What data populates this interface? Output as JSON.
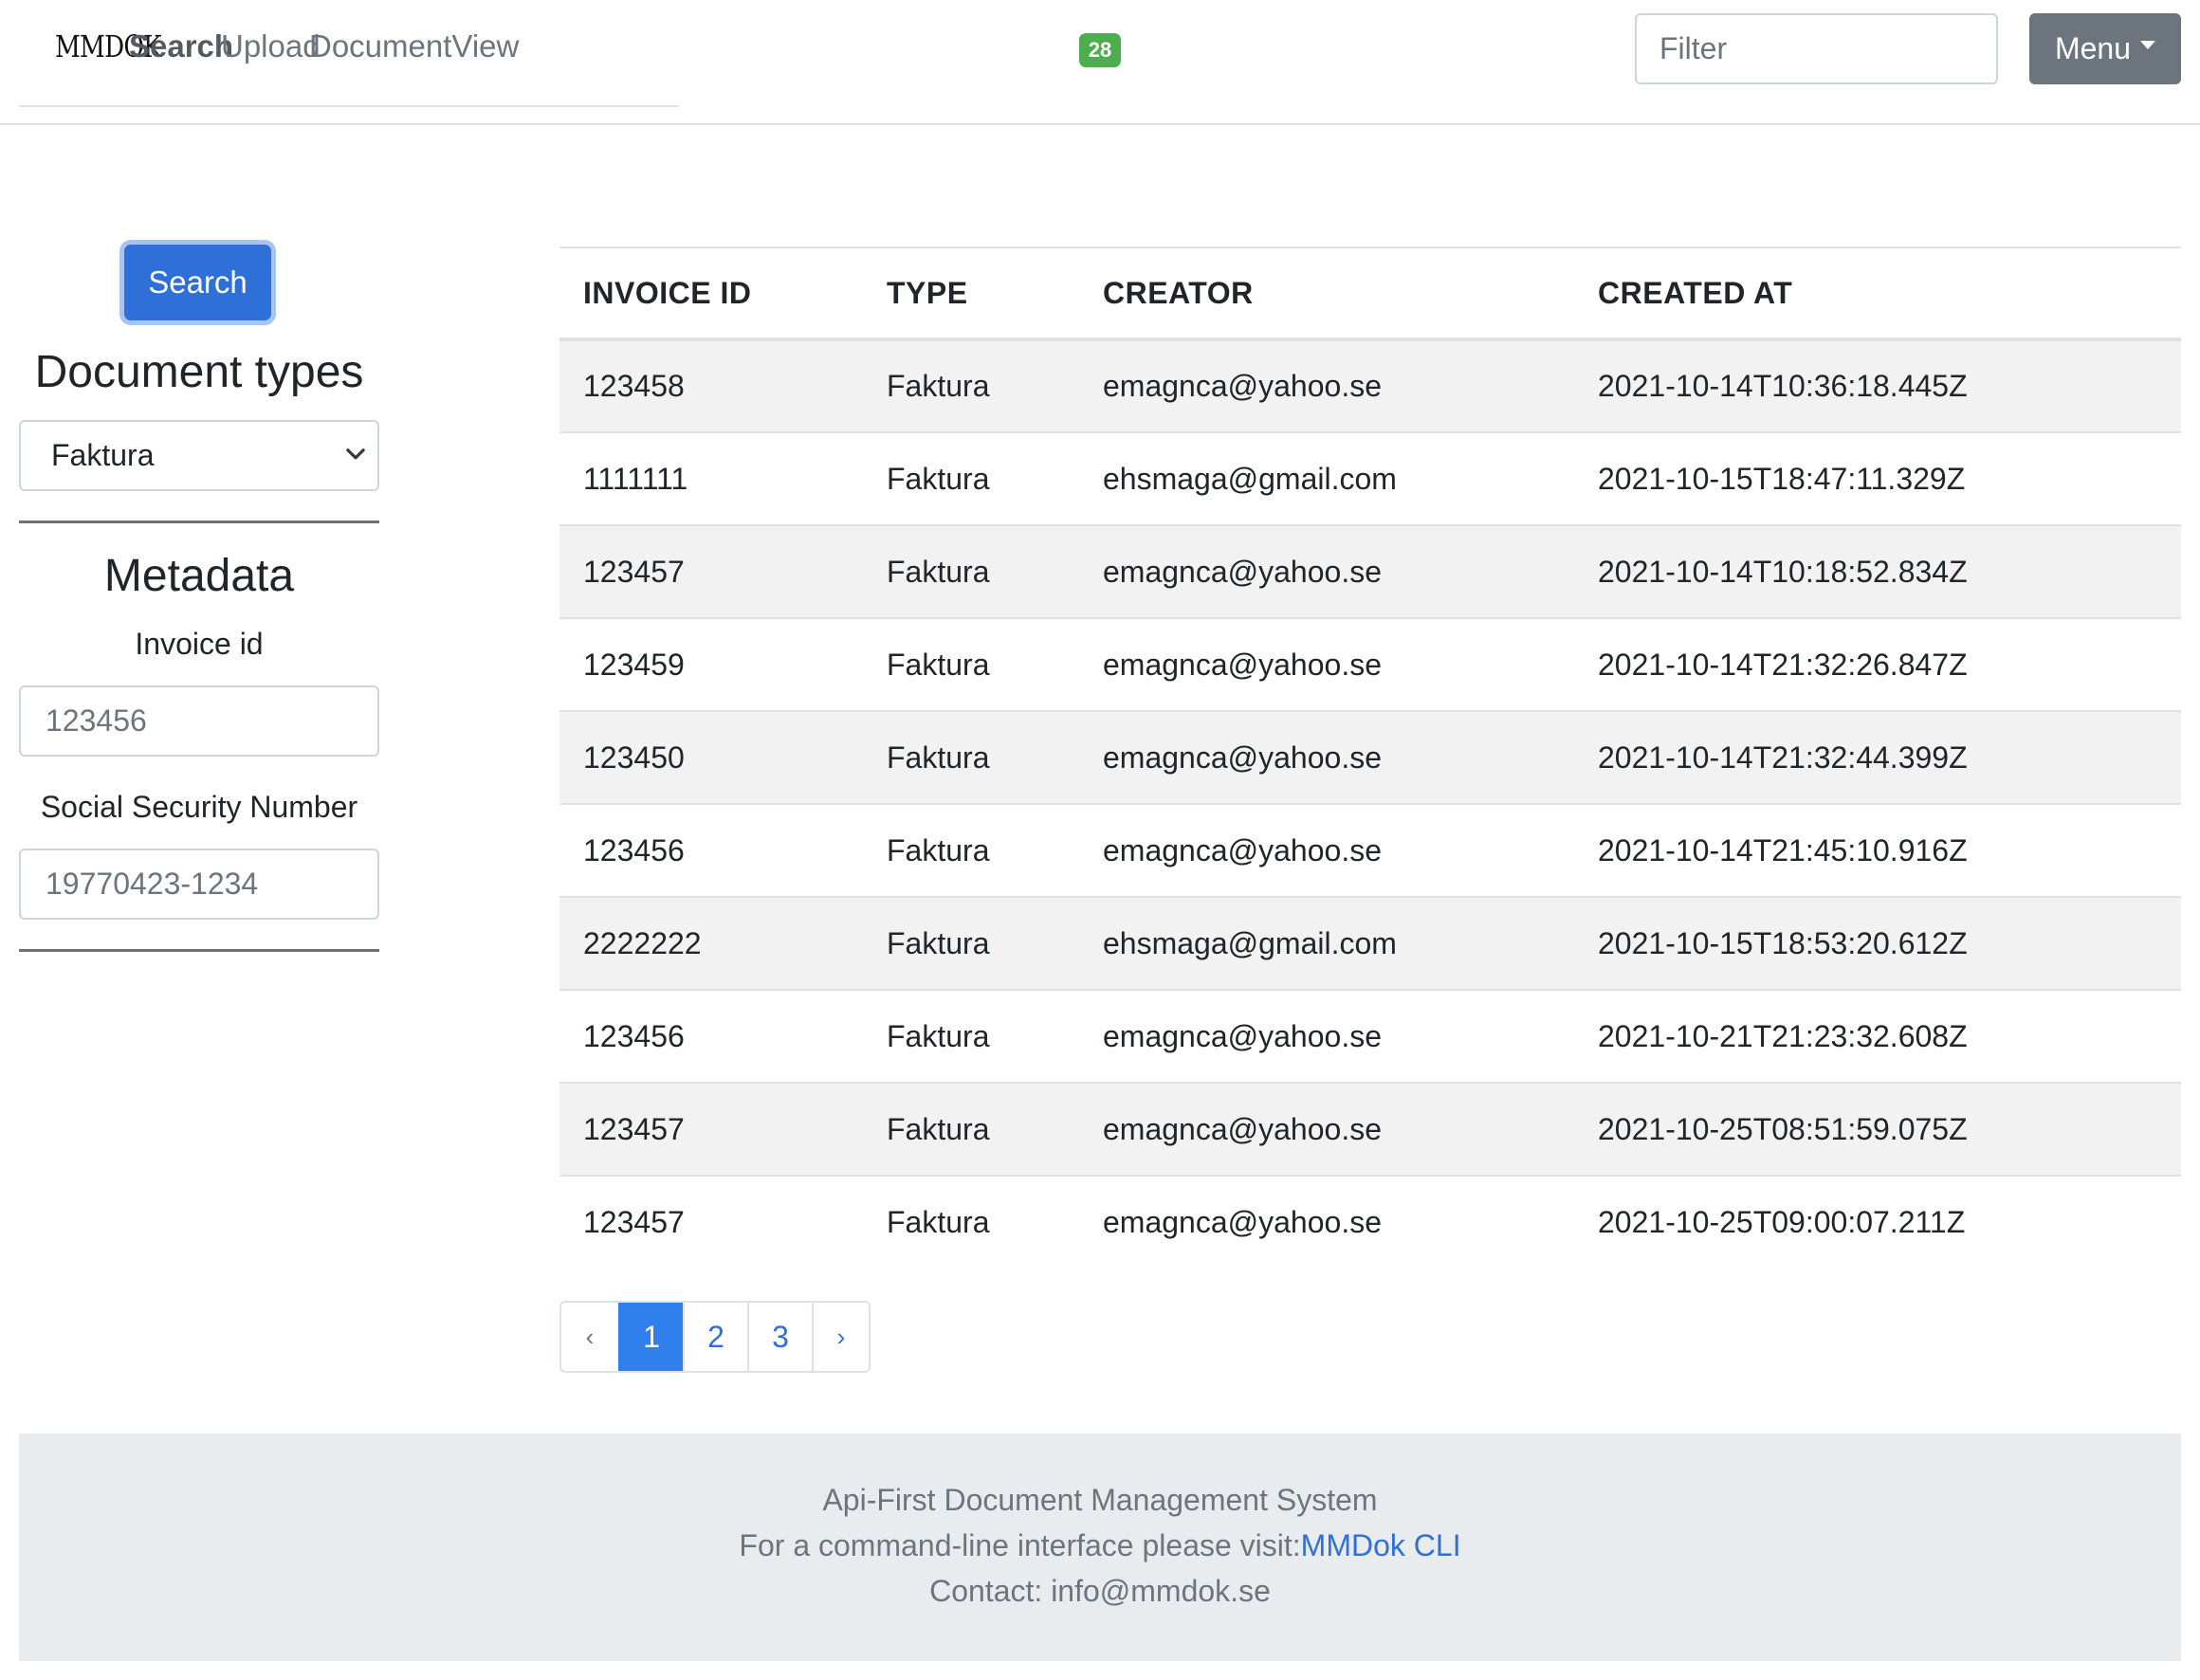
{
  "navbar": {
    "brand": "MMDOK",
    "links": [
      {
        "label": "Search",
        "active": true
      },
      {
        "label": "Upload",
        "active": false
      },
      {
        "label": "DocumentView",
        "active": false
      }
    ],
    "badge": "28",
    "filter_placeholder": "Filter",
    "menu_label": "Menu"
  },
  "sidebar": {
    "search_button": "Search",
    "document_types_heading": "Document types",
    "document_type_selected": "Faktura",
    "metadata_heading": "Metadata",
    "fields": [
      {
        "label": "Invoice id",
        "placeholder": "123456"
      },
      {
        "label": "Social Security Number",
        "placeholder": "19770423-1234"
      }
    ]
  },
  "table": {
    "headers": [
      "INVOICE ID",
      "TYPE",
      "CREATOR",
      "CREATED AT"
    ],
    "rows": [
      [
        "123458",
        "Faktura",
        "emagnca@yahoo.se",
        "2021-10-14T10:36:18.445Z"
      ],
      [
        "1111111",
        "Faktura",
        "ehsmaga@gmail.com",
        "2021-10-15T18:47:11.329Z"
      ],
      [
        "123457",
        "Faktura",
        "emagnca@yahoo.se",
        "2021-10-14T10:18:52.834Z"
      ],
      [
        "123459",
        "Faktura",
        "emagnca@yahoo.se",
        "2021-10-14T21:32:26.847Z"
      ],
      [
        "123450",
        "Faktura",
        "emagnca@yahoo.se",
        "2021-10-14T21:32:44.399Z"
      ],
      [
        "123456",
        "Faktura",
        "emagnca@yahoo.se",
        "2021-10-14T21:45:10.916Z"
      ],
      [
        "2222222",
        "Faktura",
        "ehsmaga@gmail.com",
        "2021-10-15T18:53:20.612Z"
      ],
      [
        "123456",
        "Faktura",
        "emagnca@yahoo.se",
        "2021-10-21T21:23:32.608Z"
      ],
      [
        "123457",
        "Faktura",
        "emagnca@yahoo.se",
        "2021-10-25T08:51:59.075Z"
      ],
      [
        "123457",
        "Faktura",
        "emagnca@yahoo.se",
        "2021-10-25T09:00:07.211Z"
      ]
    ]
  },
  "pagination": {
    "prev": "‹",
    "next": "›",
    "pages": [
      "1",
      "2",
      "3"
    ],
    "current": "1"
  },
  "footer": {
    "line1": "Api-First Document Management System",
    "line2_prefix": "For a command-line interface please visit:",
    "line2_link": "MMDok CLI",
    "line3": "Contact: info@mmdok.se"
  },
  "colors": {
    "primary": "#2f6fd8",
    "badge_green": "#4cae4f",
    "menu_gray": "#6c757d",
    "footer_bg": "#e9ecef",
    "stripe": "#f2f2f2"
  }
}
